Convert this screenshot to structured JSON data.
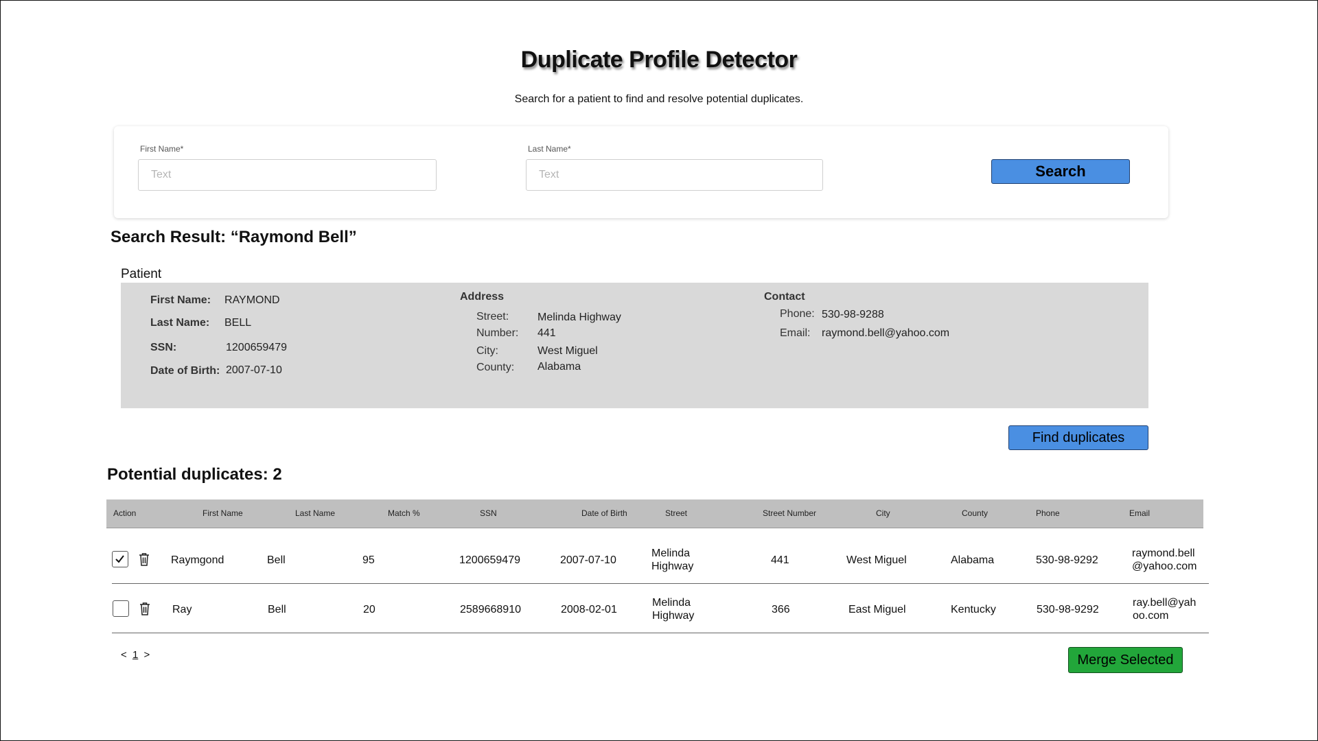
{
  "app": {
    "title": "Duplicate Profile Detector",
    "subtitle": "Search for a patient to find and resolve potential duplicates."
  },
  "search": {
    "first_name_label": "First Name*",
    "first_name_placeholder": "Text",
    "first_name_value": "",
    "last_name_label": "Last Name*",
    "last_name_placeholder": "Text",
    "last_name_value": "",
    "button_label": "Search"
  },
  "result": {
    "heading": "Search Result: “Raymond Bell”"
  },
  "patient": {
    "heading": "Patient",
    "first_name_label": "First Name:",
    "first_name": "RAYMOND",
    "last_name_label": "Last Name:",
    "last_name": "BELL",
    "ssn_label": "SSN:",
    "ssn": "1200659479",
    "dob_label": "Date of Birth:",
    "dob": "2007-07-10",
    "address": {
      "heading": "Address",
      "street_label": "Street:",
      "street": "Melinda Highway",
      "number_label": "Number:",
      "number": "441",
      "city_label": "City:",
      "city": "West Miguel",
      "county_label": "County:",
      "county": "Alabama"
    },
    "contact": {
      "heading": "Contact",
      "phone_label": "Phone:",
      "phone": "530-98-9288",
      "email_label": "Email:",
      "email": "raymond.bell@yahoo.com"
    }
  },
  "find_duplicates_label": "Find duplicates",
  "duplicates": {
    "heading": "Potential duplicates: 2",
    "columns": [
      "Action",
      "First Name",
      "Last Name",
      "Match %",
      "SSN",
      "Date of Birth",
      "Street",
      "Street Number",
      "City",
      "County",
      "Phone",
      "Email"
    ],
    "rows": [
      {
        "checked": true,
        "first_name": "Raymgond",
        "last_name": "Bell",
        "match": "95",
        "ssn": "1200659479",
        "dob": "2007-07-10",
        "street_line1": "Melinda",
        "street_line2": "Highway",
        "street_number": "441",
        "city": "West Miguel",
        "county": "Alabama",
        "phone": "530-98-9292",
        "email_line1": "raymond.bell",
        "email_line2": "@yahoo.com"
      },
      {
        "checked": false,
        "first_name": "Ray",
        "last_name": "Bell",
        "match": "20",
        "ssn": "2589668910",
        "dob": "2008-02-01",
        "street_line1": "Melinda",
        "street_line2": "Highway",
        "street_number": "366",
        "city": "East Miguel",
        "county": "Kentucky",
        "phone": "530-98-9292",
        "email_line1": "ray.bell@yah",
        "email_line2": "oo.com"
      }
    ]
  },
  "pagination": {
    "prev": "<",
    "current": "1",
    "next": ">"
  },
  "merge_label": "Merge Selected",
  "colors": {
    "primary_button": "#4a8fe2",
    "merge_button": "#22a63a",
    "patient_panel": "#d9d9d9",
    "table_header": "#bfbfbf"
  },
  "icons": {
    "row_delete": "trash-icon",
    "row_checked": "checkmark-icon"
  }
}
